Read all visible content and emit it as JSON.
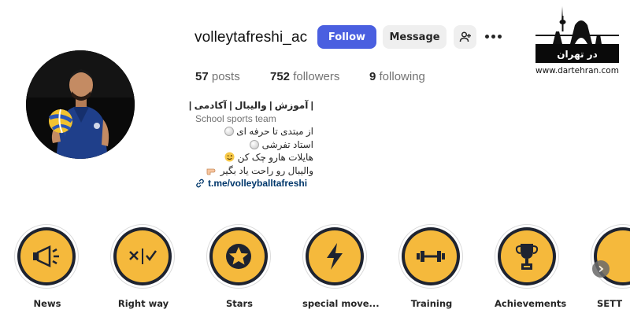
{
  "profile": {
    "username": "volleytafreshi_ac",
    "follow_label": "Follow",
    "message_label": "Message",
    "stats": {
      "posts_count": "57",
      "posts_label": "posts",
      "followers_count": "752",
      "followers_label": "followers",
      "following_count": "9",
      "following_label": "following"
    },
    "bio": {
      "title": "| آموزش | والیبال | آکادمی |",
      "category": "School sports team",
      "line1": "از مبتدی تا حرفه ای",
      "line2": "استاد تفرشی",
      "line3": "هایلات هارو چک کن",
      "line4": "والیبال رو راحت یاد بگیر",
      "link": "t.me/volleyballtafreshi"
    }
  },
  "watermark": {
    "logo_text": "در تهران",
    "url": "www.dartehran.com"
  },
  "highlights": [
    {
      "label": "News",
      "icon": "megaphone-icon"
    },
    {
      "label": "Right way",
      "icon": "cross-check-icon"
    },
    {
      "label": "Stars",
      "icon": "star-icon"
    },
    {
      "label": "special move...",
      "icon": "lightning-icon"
    },
    {
      "label": "Training",
      "icon": "dumbbell-icon"
    },
    {
      "label": "Achievements",
      "icon": "trophy-icon"
    },
    {
      "label": "SETT",
      "icon": "partial-highlight-icon"
    }
  ],
  "colors": {
    "follow_button": "#4a5fe0",
    "highlight_disc": "#f5b93c",
    "highlight_ring": "#1e2330",
    "link": "#00376b"
  }
}
